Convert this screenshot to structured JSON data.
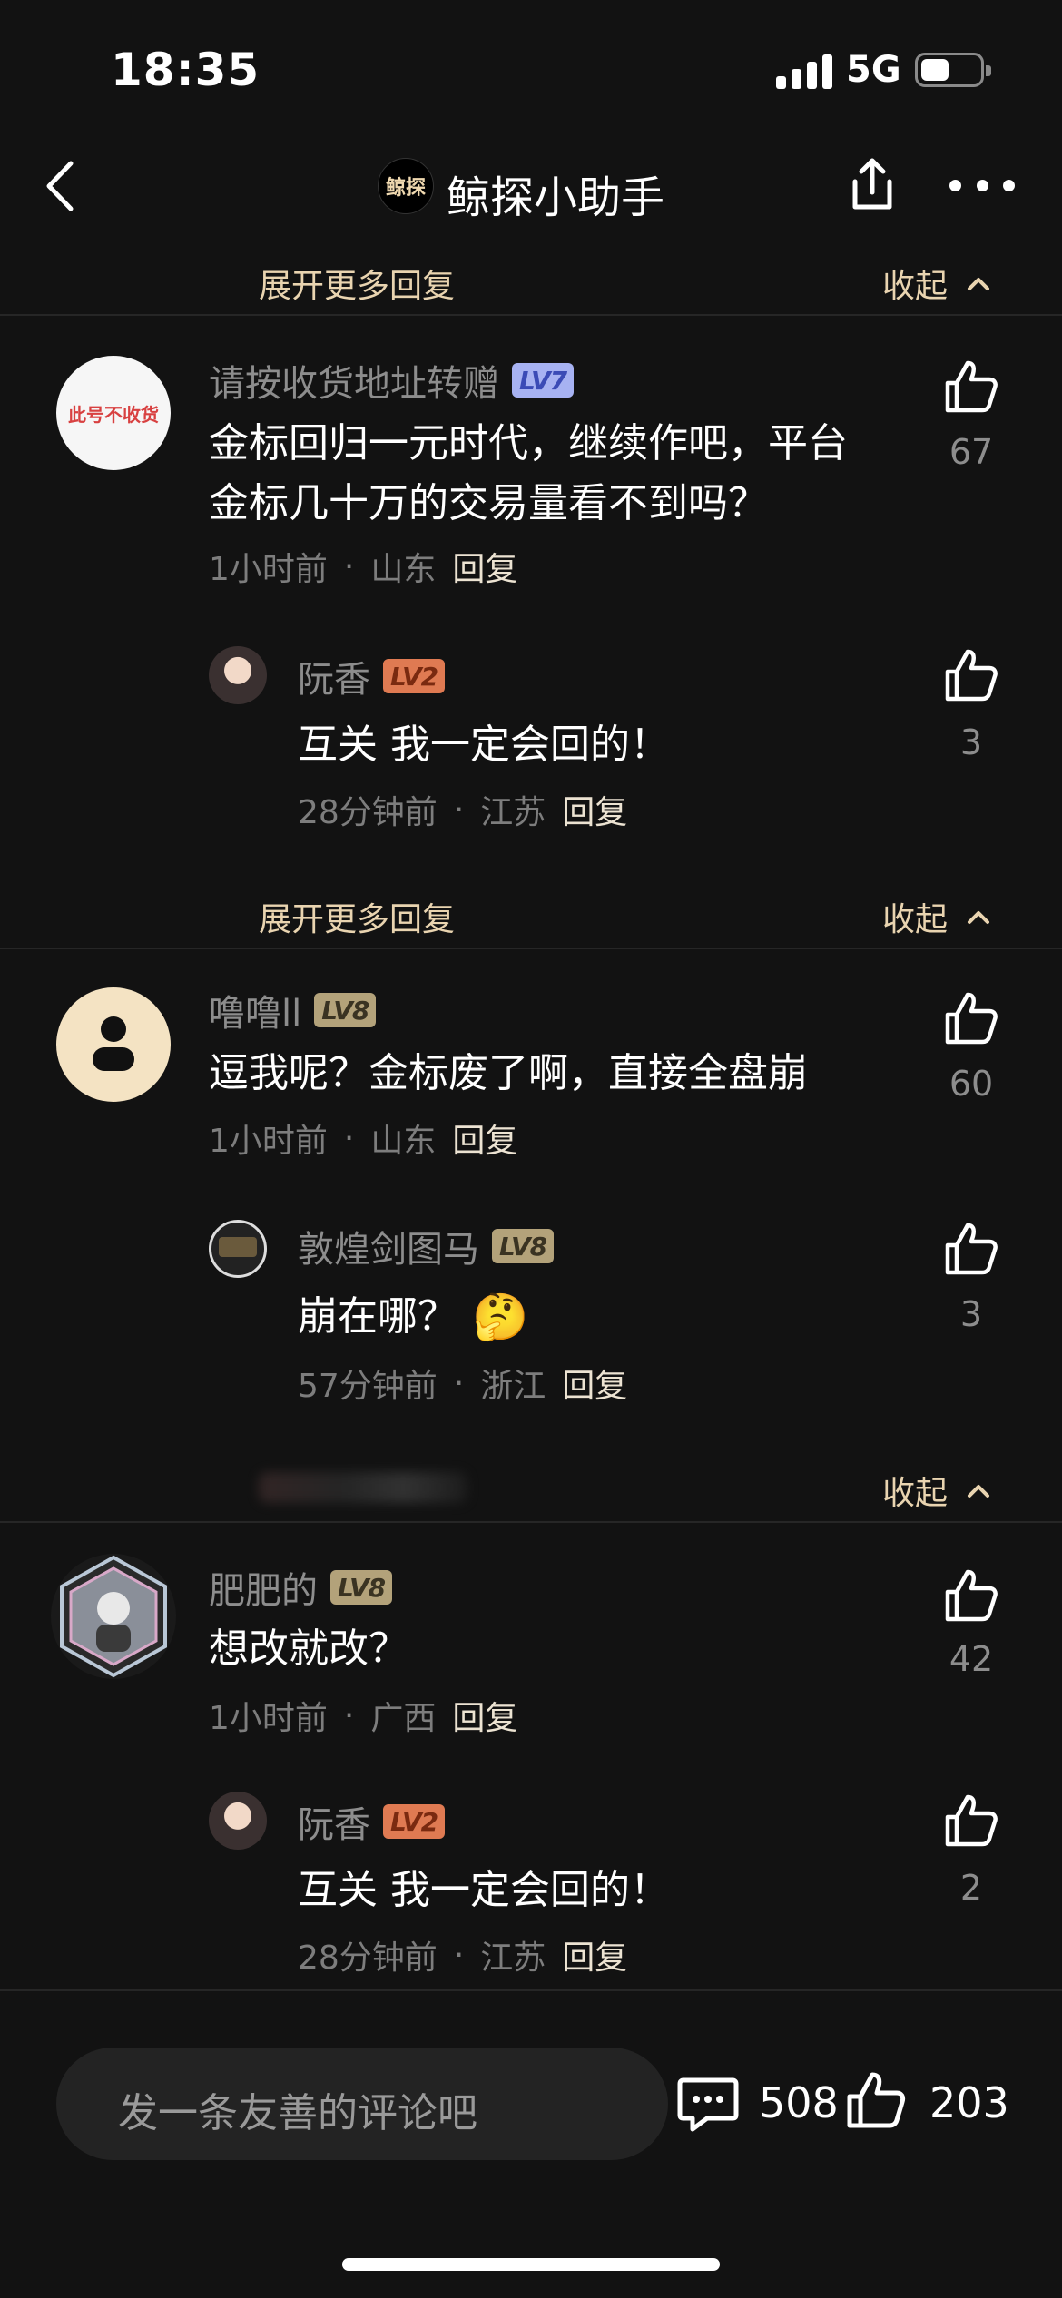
{
  "status_bar": {
    "time": "18:35",
    "network": "5G"
  },
  "nav": {
    "title": "鲸探小助手",
    "logo_text": "鲸探"
  },
  "expand_rows": [
    {
      "expand_label": "展开更多回复",
      "collapse_label": "收起"
    },
    {
      "expand_label": "展开更多回复",
      "collapse_label": "收起"
    },
    {
      "expand_label": "",
      "collapse_label": "收起"
    }
  ],
  "comments": [
    {
      "user": "请按收货地址转赠",
      "level": "LV7",
      "avatar_text": "此号不收货",
      "text_line1": "金标回归一元时代，继续作吧，平台",
      "text_line2": "金标几十万的交易量看不到吗？",
      "time": "1小时前",
      "location": "山东",
      "reply": "回复",
      "likes": "67",
      "replies": [
        {
          "user": "阮香",
          "level": "LV2",
          "text": "互关 我一定会回的！",
          "time": "28分钟前",
          "location": "江苏",
          "reply": "回复",
          "likes": "3"
        }
      ]
    },
    {
      "user": "噜噜ll",
      "level": "LV8",
      "text_line1": "逗我呢？金标废了啊，直接全盘崩",
      "time": "1小时前",
      "location": "山东",
      "reply": "回复",
      "likes": "60",
      "replies": [
        {
          "user": "敦煌剑图马",
          "level": "LV8",
          "text": "崩在哪？",
          "emoji": "🤔",
          "time": "57分钟前",
          "location": "浙江",
          "reply": "回复",
          "likes": "3"
        }
      ]
    },
    {
      "user": "肥肥的",
      "level": "LV8",
      "text_line1": "想改就改？",
      "time": "1小时前",
      "location": "广西",
      "reply": "回复",
      "likes": "42",
      "replies": [
        {
          "user": "阮香",
          "level": "LV2",
          "text": "互关 我一定会回的！",
          "time": "28分钟前",
          "location": "江苏",
          "reply": "回复",
          "likes": "2"
        }
      ]
    }
  ],
  "bottom_bar": {
    "placeholder": "发一条友善的评论吧",
    "comment_count": "508",
    "like_count": "203"
  },
  "meta_separator": "·"
}
